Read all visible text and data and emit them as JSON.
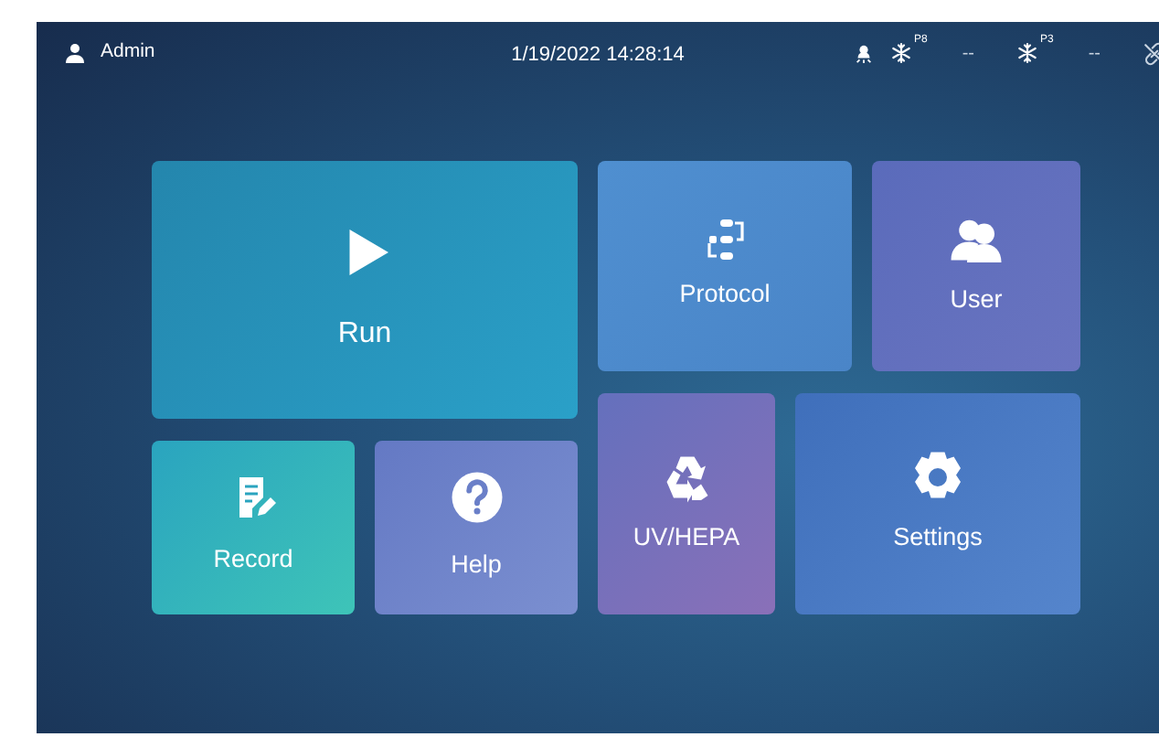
{
  "status_bar": {
    "user": "Admin",
    "datetime": "1/19/2022 14:28:14",
    "indicators": [
      {
        "kind": "lamp"
      },
      {
        "kind": "fan",
        "tag": "P8",
        "value": "--"
      },
      {
        "kind": "fan",
        "tag": "P3",
        "value": "--"
      },
      {
        "kind": "link"
      }
    ]
  },
  "tiles": [
    {
      "kind": "run",
      "label": "Run"
    },
    {
      "kind": "protocol",
      "label": "Protocol"
    },
    {
      "kind": "user",
      "label": "User"
    },
    {
      "kind": "record",
      "label": "Record"
    },
    {
      "kind": "help",
      "label": "Help"
    },
    {
      "kind": "uv",
      "label": "UV/HEPA"
    },
    {
      "kind": "settings",
      "label": "Settings"
    }
  ]
}
